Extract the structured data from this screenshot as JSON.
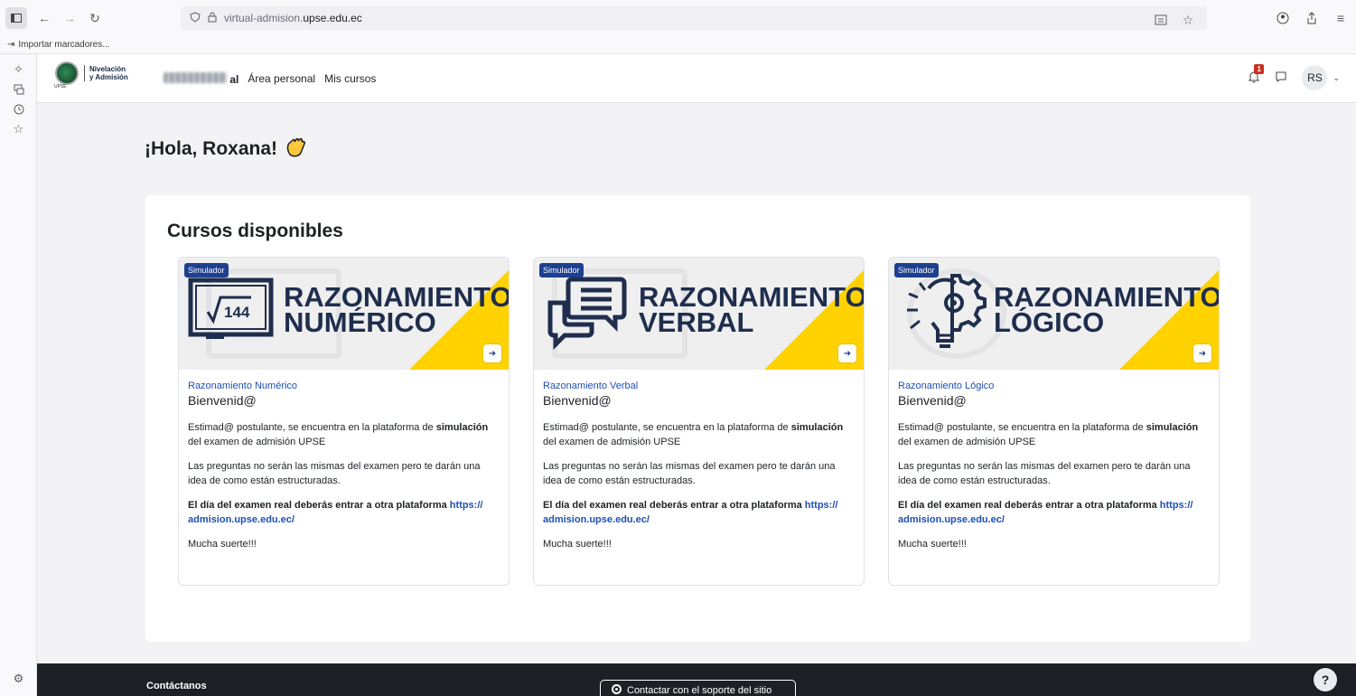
{
  "browser": {
    "url_prefix": "virtual-admision.",
    "url_domain": "upse.edu.ec",
    "bookmark_label": "Importar marcadores..."
  },
  "nav": {
    "logo_line1": "Nivelación",
    "logo_line2": "y Admisión",
    "logo_sub": "UPSE",
    "site_suffix": "al",
    "links": [
      "Área personal",
      "Mis cursos"
    ],
    "notification_count": "1",
    "avatar_initials": "RS"
  },
  "greeting": "¡Hola, Roxana!",
  "section_title": "Cursos disponibles",
  "courses": [
    {
      "badge": "Simulador",
      "image_line1": "RAZONAMIENTO",
      "image_line2": "NUMÉRICO",
      "name": "Razonamiento Numérico",
      "heading": "Bienvenid@",
      "p1_pre": "Estimad@ postulante, se encuentra en la plataforma de",
      "p1_bold": "simulación",
      "p1_post": "del examen de admisión UPSE",
      "p2": "Las preguntas no serán las mismas del examen pero te darán una idea de como están estructuradas.",
      "p3_bold": "El día del examen real deberás entrar a otra plataforma",
      "p3_link": "https:// admision.upse.edu.ec/",
      "p4": "Mucha suerte!!!"
    },
    {
      "badge": "Simulador",
      "image_line1": "RAZONAMIENTO",
      "image_line2": "VERBAL",
      "name": "Razonamiento Verbal",
      "heading": "Bienvenid@",
      "p1_pre": "Estimad@ postulante, se encuentra en la plataforma de",
      "p1_bold": "simulación",
      "p1_post": "del examen de admisión UPSE",
      "p2": "Las preguntas no serán las mismas del examen pero te darán una idea de como están estructuradas.",
      "p3_bold": "El día del examen real deberás entrar a otra plataforma",
      "p3_link": "https:// admision.upse.edu.ec/",
      "p4": "Mucha suerte!!!"
    },
    {
      "badge": "Simulador",
      "image_line1": "RAZONAMIENTO",
      "image_line2": "LÓGICO",
      "name": "Razonamiento Lógico",
      "heading": "Bienvenid@",
      "p1_pre": "Estimad@ postulante, se encuentra en la plataforma de",
      "p1_bold": "simulación",
      "p1_post": "del examen de admisión UPSE",
      "p2": "Las preguntas no serán las mismas del examen pero te darán una idea de como están estructuradas.",
      "p3_bold": "El día del examen real deberás entrar a otra plataforma",
      "p3_link": "https:// admision.upse.edu.ec/",
      "p4": "Mucha suerte!!!"
    }
  ],
  "footer": {
    "title": "Contáctanos",
    "support_button": "Contactar con el soporte del sitio"
  },
  "help_label": "?",
  "colors": {
    "accent": "#1e50b4",
    "badge_bg": "#1e3f8f",
    "yellow": "#ffd200",
    "footer_bg": "#1d2125"
  }
}
